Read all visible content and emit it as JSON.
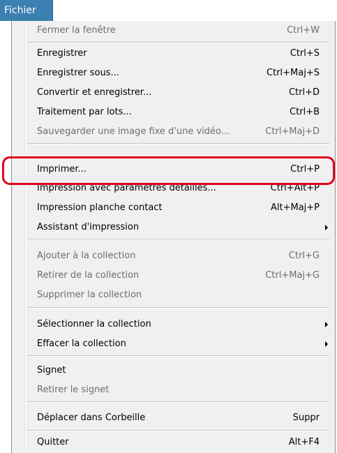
{
  "menu": {
    "title": "Fichier",
    "items": [
      {
        "label": "Fermer la fenêtre",
        "shortcut": "Ctrl+W",
        "enabled": false
      },
      {
        "label": "Enregistrer",
        "shortcut": "Ctrl+S",
        "enabled": true
      },
      {
        "label": "Enregistrer sous...",
        "shortcut": "Ctrl+Maj+S",
        "enabled": true
      },
      {
        "label": "Convertir et enregistrer...",
        "shortcut": "Ctrl+D",
        "enabled": true
      },
      {
        "label": "Traitement par lots...",
        "shortcut": "Ctrl+B",
        "enabled": true
      },
      {
        "label": "Sauvegarder une image fixe d'une vidéo...",
        "shortcut": "Ctrl+Maj+D",
        "enabled": false
      },
      {
        "label": "Imprimer...",
        "shortcut": "Ctrl+P",
        "enabled": true
      },
      {
        "label": "Impression avec paramètres détaillés...",
        "shortcut": "Ctrl+Alt+P",
        "enabled": true
      },
      {
        "label": "Impression planche contact",
        "shortcut": "Alt+Maj+P",
        "enabled": true
      },
      {
        "label": "Assistant d'impression",
        "shortcut": "",
        "enabled": true,
        "submenu": true
      },
      {
        "label": "Ajouter à la collection",
        "shortcut": "Ctrl+G",
        "enabled": false
      },
      {
        "label": "Retirer de la collection",
        "shortcut": "Ctrl+Maj+G",
        "enabled": false
      },
      {
        "label": "Supprimer la collection",
        "shortcut": "",
        "enabled": false
      },
      {
        "label": "Sélectionner la collection",
        "shortcut": "",
        "enabled": true,
        "submenu": true
      },
      {
        "label": "Effacer la collection",
        "shortcut": "",
        "enabled": true,
        "submenu": true
      },
      {
        "label": "Signet",
        "shortcut": "",
        "enabled": true
      },
      {
        "label": "Retirer le signet",
        "shortcut": "",
        "enabled": false
      },
      {
        "label": "Déplacer dans Corbeille",
        "shortcut": "Suppr",
        "enabled": true
      },
      {
        "label": "Quitter",
        "shortcut": "Alt+F4",
        "enabled": true
      }
    ],
    "highlighted_item": "Imprimer..."
  },
  "colors": {
    "menu_title_bg": "#3c7fb1",
    "menu_bg": "#f0f0f0",
    "disabled_text": "#6d6d6d",
    "highlight_outline": "#e0001b"
  }
}
